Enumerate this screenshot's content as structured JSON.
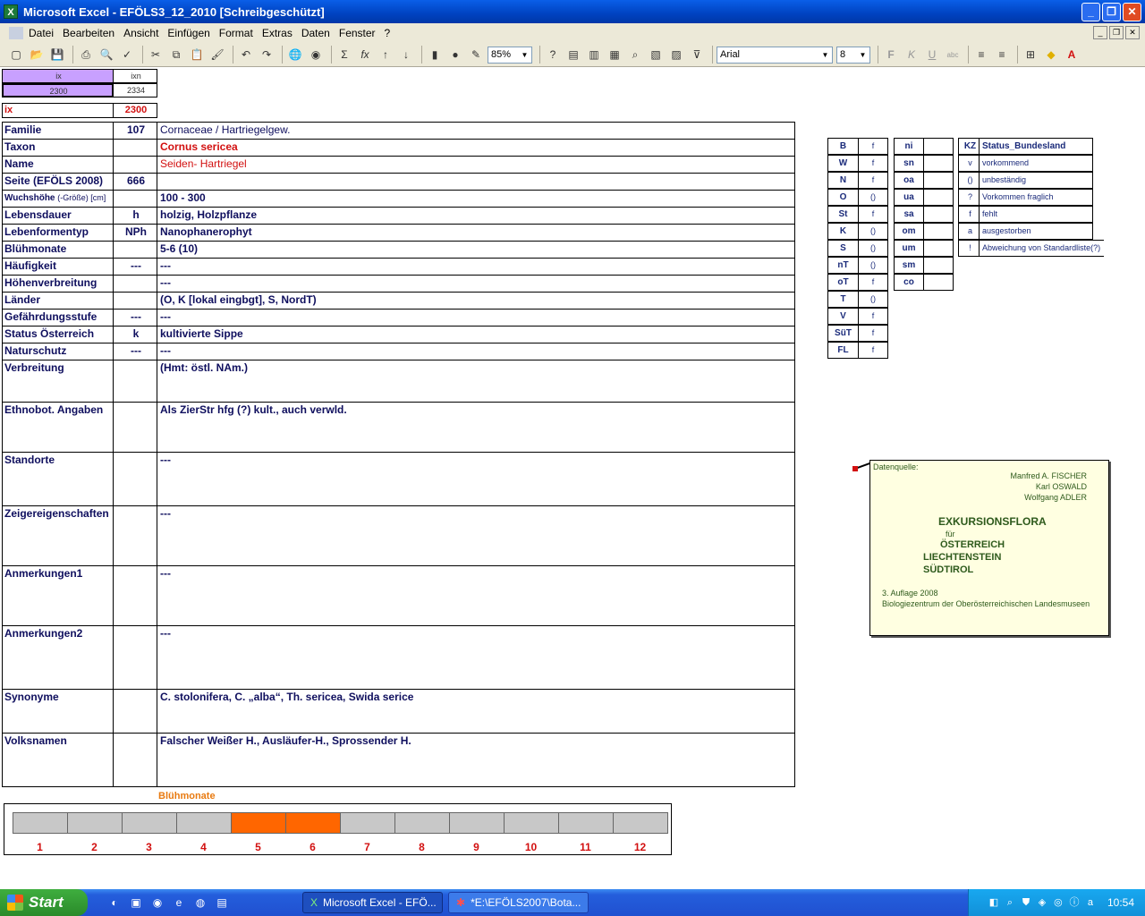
{
  "window": {
    "title": "Microsoft Excel - EFÖLS3_12_2010  [Schreibgeschützt]"
  },
  "menu": [
    "Datei",
    "Bearbeiten",
    "Ansicht",
    "Einfügen",
    "Format",
    "Extras",
    "Daten",
    "Fenster",
    "?"
  ],
  "toolbar": {
    "zoom": "85%",
    "font": "Arial",
    "font_size": "8"
  },
  "header": {
    "ix_label": "ix",
    "ixn_label": "ixn",
    "ix_value": "2300",
    "ixn_value": "2334",
    "ix2_label": "ix",
    "ix2_value": "2300"
  },
  "rows": [
    {
      "label": "Familie",
      "code": "107",
      "text": "Cornaceae  /  Hartriegelgew."
    },
    {
      "label": "Taxon",
      "code": "",
      "text": "Cornus sericea"
    },
    {
      "label": "Name",
      "code": "",
      "text": "Seiden- Hartriegel"
    },
    {
      "label": "Seite (EFÖLS 2008)",
      "code": "666",
      "text": ""
    },
    {
      "label": "Wuchshöhe",
      "label_extra": "(-Größe) [cm]",
      "code": "",
      "text": " 100 - 300"
    },
    {
      "label": "Lebensdauer",
      "code": "h",
      "text": "holzig, Holzpflanze"
    },
    {
      "label": "Lebenformentyp",
      "code": "NPh",
      "text": "Nanophanerophyt"
    },
    {
      "label": "Blühmonate",
      "code": "",
      "text": " 5-6 (10)"
    },
    {
      "label": "Häufigkeit",
      "code": "---",
      "text": " ---"
    },
    {
      "label": "Höhenverbreitung",
      "code": "",
      "text": " ---"
    },
    {
      "label": "Länder",
      "code": "",
      "text": "(O, K [lokal eingbgt], S, NordT)"
    },
    {
      "label": "Gefährdungsstufe",
      "code": "---",
      "text": "   ---"
    },
    {
      "label": "Status Österreich",
      "code": "k",
      "text": "kultivierte Sippe"
    },
    {
      "label": "Naturschutz",
      "code": "---",
      "text": " ---"
    },
    {
      "label": "Verbreitung",
      "code": "",
      "text": "(Hmt: östl. NAm.)"
    },
    {
      "label": "Ethnobot. Angaben",
      "code": "",
      "text": "Als ZierStr hfg (?) kult., auch verwld."
    },
    {
      "label": "Standorte",
      "code": "",
      "text": "---"
    },
    {
      "label": "Zeigereigenschaften",
      "code": "",
      "text": "---"
    },
    {
      "label": "Anmerkungen1",
      "code": "",
      "text": "---"
    },
    {
      "label": "Anmerkungen2",
      "code": "",
      "text": "---"
    },
    {
      "label": "Synonyme",
      "code": "",
      "text": "C. stolonifera, C. „alba“, Th. sericea, Swida serice"
    },
    {
      "label": "Volksnamen",
      "code": "",
      "text": "Falscher Weißer H., Ausläufer-H., Sprossender H."
    }
  ],
  "regions1": [
    {
      "k": "B",
      "v": "f"
    },
    {
      "k": "W",
      "v": "f"
    },
    {
      "k": "N",
      "v": "f"
    },
    {
      "k": "O",
      "v": "()"
    },
    {
      "k": "St",
      "v": "f"
    },
    {
      "k": "K",
      "v": "()"
    },
    {
      "k": "S",
      "v": "()"
    },
    {
      "k": "nT",
      "v": "()"
    },
    {
      "k": "oT",
      "v": "f"
    },
    {
      "k": "T",
      "v": "()"
    },
    {
      "k": "V",
      "v": "f"
    },
    {
      "k": "SüT",
      "v": "f"
    },
    {
      "k": "FL",
      "v": "f"
    }
  ],
  "regions2": [
    {
      "k": "ni",
      "v": ""
    },
    {
      "k": "sn",
      "v": ""
    },
    {
      "k": "oa",
      "v": ""
    },
    {
      "k": "ua",
      "v": ""
    },
    {
      "k": "sa",
      "v": ""
    },
    {
      "k": "om",
      "v": ""
    },
    {
      "k": "um",
      "v": ""
    },
    {
      "k": "sm",
      "v": ""
    },
    {
      "k": "co",
      "v": ""
    }
  ],
  "status_legend": {
    "header_kz": "KZ",
    "header_label": "Status_Bundesland",
    "items": [
      {
        "kz": "v",
        "label": "vorkommend"
      },
      {
        "kz": "()",
        "label": "unbeständig"
      },
      {
        "kz": "?",
        "label": "Vorkommen fraglich"
      },
      {
        "kz": "f",
        "label": "fehlt"
      },
      {
        "kz": "a",
        "label": "ausgestorben"
      },
      {
        "kz": "!",
        "label": "Abweichung von Standardliste(?)"
      }
    ]
  },
  "comment": {
    "source_label": "Datenquelle:",
    "authors": [
      "Manfred A. FISCHER",
      "Karl OSWALD",
      "Wolfgang ADLER"
    ],
    "title": "EXKURSIONSFLORA",
    "fuer": "für",
    "countries": [
      "ÖSTERREICH",
      "LIECHTENSTEIN",
      "SÜDTIROL"
    ],
    "edition": "3. Auflage 2008",
    "publisher": "Biologiezentrum der Oberösterreichischen Landesmuseen"
  },
  "bloom": {
    "title": "Blühmonate",
    "months": [
      "1",
      "2",
      "3",
      "4",
      "5",
      "6",
      "7",
      "8",
      "9",
      "10",
      "11",
      "12"
    ],
    "active": [
      5,
      6
    ],
    "active_color": "#ff6600"
  },
  "taskbar": {
    "start": "Start",
    "tasks": [
      "Microsoft Excel - EFÖ...",
      "*E:\\EFÖLS2007\\Bota..."
    ],
    "clock": "10:54"
  }
}
